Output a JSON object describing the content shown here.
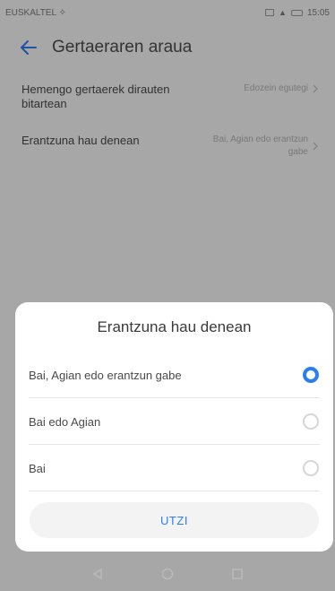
{
  "status_bar": {
    "carrier": "EUSKALTEL ✧",
    "time": "15:05"
  },
  "app_bar": {
    "title": "Gertaeraren araua"
  },
  "settings": [
    {
      "label": "Hemengo gertaerek dirauten bitartean",
      "value": "Edozein egutegi"
    },
    {
      "label": "Erantzuna hau denean",
      "value": "Bai, Agian edo erantzun gabe"
    }
  ],
  "dialog": {
    "title": "Erantzuna hau denean",
    "options": [
      {
        "label": "Bai, Agian edo erantzun gabe",
        "checked": true
      },
      {
        "label": "Bai edo Agian",
        "checked": false
      },
      {
        "label": "Bai",
        "checked": false
      }
    ],
    "cancel_label": "UTZI"
  },
  "colors": {
    "accent": "#2b7ef0",
    "overlay": "rgba(0,0,0,0.33)"
  },
  "icons": {
    "back": "arrow-left-icon",
    "chevron": "chevron-right-icon",
    "nav_back": "triangle-back-icon",
    "nav_home": "circle-home-icon",
    "nav_recent": "square-recent-icon"
  }
}
